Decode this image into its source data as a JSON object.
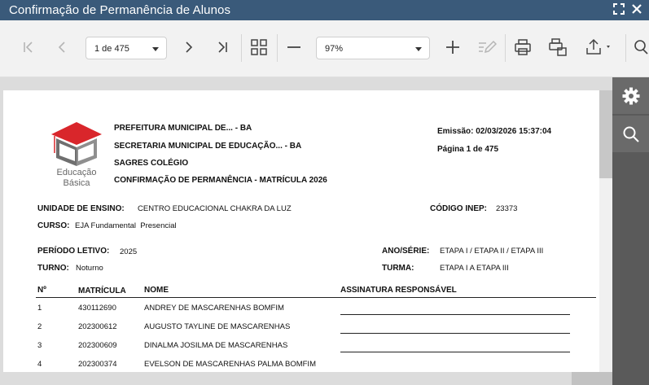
{
  "window": {
    "title": "Confirmação de Permanência de Alunos"
  },
  "toolbar": {
    "page_select": "1 de 475",
    "zoom_select": "97%"
  },
  "report": {
    "header_lines": [
      "PREFEITURA MUNICIPAL DE... - BA",
      "SECRETARIA MUNICIPAL DE EDUCAÇÃO... - BA",
      "SAGRES COLÉGIO",
      "CONFIRMAÇÃO DE PERMANÊNCIA - MATRÍCULA 2026"
    ],
    "emission": "Emissão: 02/03/2026 15:37:04",
    "page_info": "Página 1 de 475",
    "logo_caption_1": "Educação",
    "logo_caption_2": "Básica",
    "unidade_label": "UNIDADE DE ENSINO:",
    "unidade_value": "CENTRO EDUCACIONAL CHAKRA DA LUZ",
    "inep_label": "CÓDIGO INEP:",
    "inep_value": "23373",
    "curso_label": "CURSO:",
    "curso_value": "EJA Fundamental  Presencial",
    "periodo_label": "PERÍODO LETIVO:",
    "periodo_value": "2025",
    "ano_label": "ANO/SÉRIE:",
    "ano_value": "ETAPA I / ETAPA II / ETAPA III",
    "turno_label": "TURNO:",
    "turno_value": "Noturno",
    "turma_label": "TURMA:",
    "turma_value": "ETAPA I A ETAPA III",
    "columns": [
      "Nº",
      "MATRÍCULA",
      "NOME",
      "ASSINATURA RESPONSÁVEL"
    ],
    "rows": [
      {
        "n": "1",
        "matricula": "430112690",
        "nome": "ANDREY DE MASCARENHAS BOMFIM"
      },
      {
        "n": "2",
        "matricula": "202300612",
        "nome": "AUGUSTO TAYLINE DE MASCARENHAS"
      },
      {
        "n": "3",
        "matricula": "202300609",
        "nome": "DINALMA JOSILMA DE MASCARENHAS"
      },
      {
        "n": "4",
        "matricula": "202300374",
        "nome": "EVELSON DE MASCARENHAS PALMA BOMFIM"
      }
    ]
  },
  "colors": {
    "titlebar": "#3a5a7a",
    "toolbar": "#f2f2f2",
    "sidepanel": "#5a5a5a",
    "logo_red": "#d9262b"
  }
}
